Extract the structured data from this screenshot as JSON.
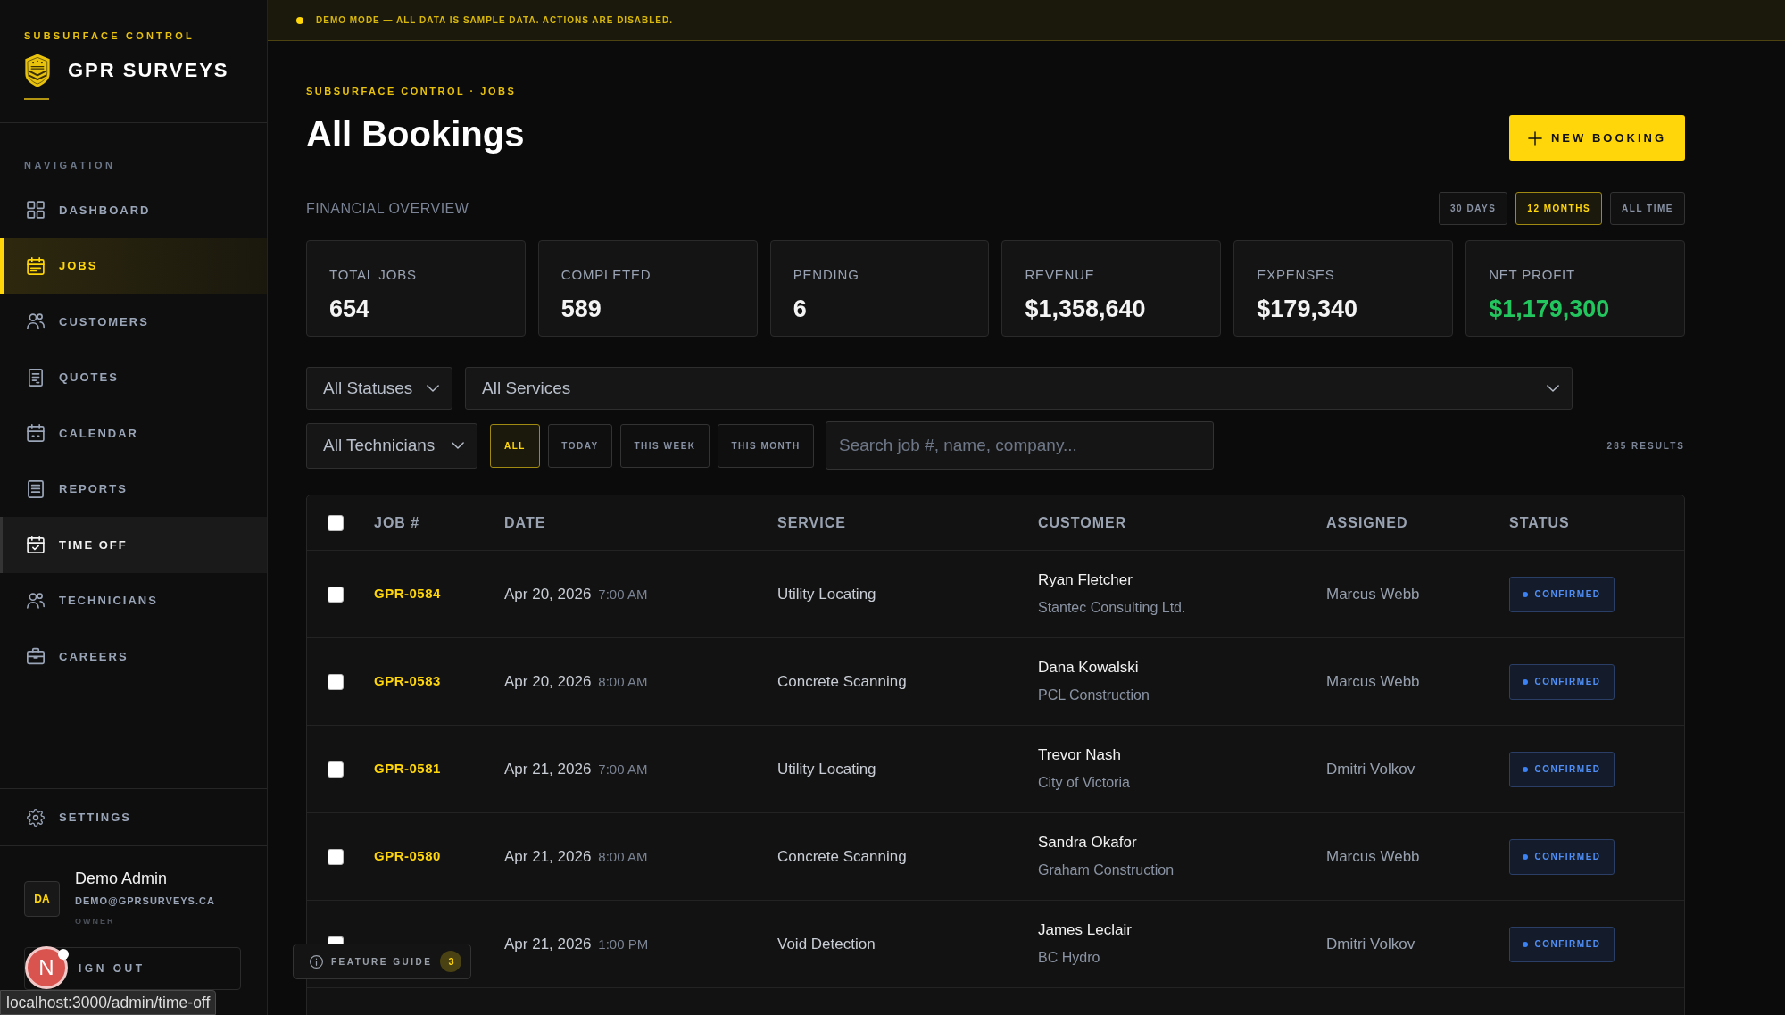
{
  "sidebar": {
    "brand_tagline": "SUBSURFACE CONTROL",
    "brand_name": "GPR SURVEYS",
    "section_label": "NAVIGATION",
    "items": [
      {
        "label": "DASHBOARD",
        "selected": false,
        "hovered": false
      },
      {
        "label": "JOBS",
        "selected": true,
        "hovered": false
      },
      {
        "label": "CUSTOMERS",
        "selected": false,
        "hovered": false
      },
      {
        "label": "QUOTES",
        "selected": false,
        "hovered": false
      },
      {
        "label": "CALENDAR",
        "selected": false,
        "hovered": false
      },
      {
        "label": "REPORTS",
        "selected": false,
        "hovered": false
      },
      {
        "label": "TIME OFF",
        "selected": false,
        "hovered": true
      },
      {
        "label": "TECHNICIANS",
        "selected": false,
        "hovered": false
      },
      {
        "label": "CAREERS",
        "selected": false,
        "hovered": false
      }
    ],
    "settings": {
      "label": "SETTINGS"
    },
    "user": {
      "initials": "DA",
      "name": "Demo Admin",
      "email": "DEMO@GPRSURVEYS.CA",
      "role": "OWNER"
    },
    "sign_out": "IGN OUT"
  },
  "demo_banner": "DEMO MODE — ALL DATA IS SAMPLE DATA. ACTIONS ARE DISABLED.",
  "header": {
    "breadcrumb": "SUBSURFACE CONTROL · JOBS",
    "title": "All Bookings",
    "new_button": "NEW BOOKING"
  },
  "financial_overview": {
    "label": "FINANCIAL OVERVIEW",
    "ranges": [
      {
        "label": "30 DAYS",
        "selected": false
      },
      {
        "label": "12 MONTHS",
        "selected": true
      },
      {
        "label": "ALL TIME",
        "selected": false
      }
    ],
    "stats": [
      {
        "label": "TOTAL JOBS",
        "value": "654",
        "kind": "plain"
      },
      {
        "label": "COMPLETED",
        "value": "589",
        "kind": "plain"
      },
      {
        "label": "PENDING",
        "value": "6",
        "kind": "plain"
      },
      {
        "label": "REVENUE",
        "value": "$1,358,640",
        "kind": "plain"
      },
      {
        "label": "EXPENSES",
        "value": "$179,340",
        "kind": "plain"
      },
      {
        "label": "NET PROFIT",
        "value": "$1,179,300",
        "kind": "profit"
      }
    ]
  },
  "filters": {
    "status_select": "All Statuses",
    "service_select": "All Services",
    "technician_select": "All Technicians",
    "periods": [
      {
        "label": "ALL",
        "selected": true
      },
      {
        "label": "TODAY",
        "selected": false
      },
      {
        "label": "THIS WEEK",
        "selected": false
      },
      {
        "label": "THIS MONTH",
        "selected": false
      }
    ],
    "search": {
      "placeholder": "Search job #, name, company..."
    },
    "results": "285 RESULTS"
  },
  "table": {
    "select_all": {
      "checked": false
    },
    "columns": [
      "JOB #",
      "DATE",
      "SERVICE",
      "CUSTOMER",
      "ASSIGNED",
      "STATUS"
    ],
    "rows": [
      {
        "checked": false,
        "job": "GPR-0584",
        "date": "Apr 20, 2026",
        "time": "7:00 AM",
        "service": "Utility Locating",
        "customer": "Ryan Fletcher",
        "company": "Stantec Consulting Ltd.",
        "assigned": "Marcus Webb",
        "status": "CONFIRMED"
      },
      {
        "checked": false,
        "job": "GPR-0583",
        "date": "Apr 20, 2026",
        "time": "8:00 AM",
        "service": "Concrete Scanning",
        "customer": "Dana Kowalski",
        "company": "PCL Construction",
        "assigned": "Marcus Webb",
        "status": "CONFIRMED"
      },
      {
        "checked": false,
        "job": "GPR-0581",
        "date": "Apr 21, 2026",
        "time": "7:00 AM",
        "service": "Utility Locating",
        "customer": "Trevor Nash",
        "company": "City of Victoria",
        "assigned": "Dmitri Volkov",
        "status": "CONFIRMED"
      },
      {
        "checked": false,
        "job": "GPR-0580",
        "date": "Apr 21, 2026",
        "time": "8:00 AM",
        "service": "Concrete Scanning",
        "customer": "Sandra Okafor",
        "company": "Graham Construction",
        "assigned": "Marcus Webb",
        "status": "CONFIRMED"
      },
      {
        "checked": false,
        "date": "Apr 21, 2026",
        "time": "1:00 PM",
        "service": "Void Detection",
        "customer": "James Leclair",
        "company": "BC Hydro",
        "assigned": "Dmitri Volkov",
        "status": "CONFIRMED"
      }
    ]
  },
  "feature_guide": {
    "label": "FEATURE GUIDE",
    "count": "3"
  },
  "dev_indicator": {
    "letter": "N"
  },
  "status_url": "localhost:3000/admin/time-off"
}
